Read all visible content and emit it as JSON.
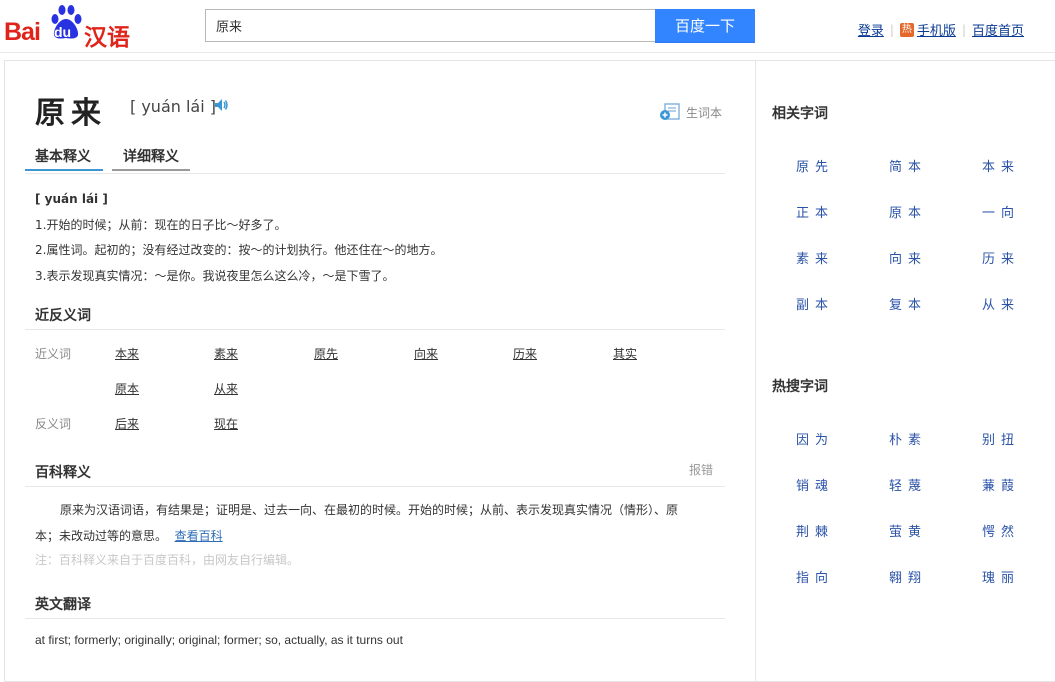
{
  "header": {
    "logo": {
      "bai": "Bai",
      "du": "du",
      "hanyu": "汉语"
    },
    "search_value": "原来",
    "search_button": "百度一下",
    "links": {
      "login": "登录",
      "hot_badge": "热",
      "mobile": "手机版",
      "home": "百度首页"
    }
  },
  "entry": {
    "word": "原来",
    "pinyin": "[ yuán lái ]",
    "add_newword": "生词本",
    "tabs": [
      "基本释义",
      "详细释义"
    ],
    "basic": {
      "pinyin": "[ yuán lái ]",
      "defs": [
        "1.开始的时候；从前：现在的日子比～好多了。",
        "2.属性词。起初的；没有经过改变的：按～的计划执行。他还住在～的地方。",
        "3.表示发现真实情况：～是你。我说夜里怎么这么冷，～是下雪了。"
      ]
    },
    "synonyms_section": {
      "title": "近反义词",
      "synonym_label": "近义词",
      "synonyms": [
        "本来",
        "素来",
        "原先",
        "向来",
        "历来",
        "其实",
        "原本",
        "从来"
      ],
      "antonym_label": "反义词",
      "antonyms": [
        "后来",
        "现在"
      ]
    },
    "baike": {
      "title": "百科释义",
      "report": "报错",
      "text": "原来为汉语词语，有结果是；证明是、过去一向、在最初的时候。开始的时候；从前、表示发现真实情况（情形）、原本；未改动过等的意思。",
      "link": "查看百科",
      "note": "注：百科释义来自于百度百科，由网友自行编辑。"
    },
    "english": {
      "title": "英文翻译",
      "text": "at first; formerly; originally; original; former; so, actually, as it turns out"
    }
  },
  "sidebar": {
    "related_title": "相关字词",
    "related": [
      "原先",
      "简本",
      "本来",
      "正本",
      "原本",
      "一向",
      "素来",
      "向来",
      "历来",
      "副本",
      "复本",
      "从来"
    ],
    "hot_title": "热搜字词",
    "hot": [
      "因为",
      "朴素",
      "别扭",
      "销魂",
      "轻蔑",
      "蒹葭",
      "荆棘",
      "萤黄",
      "愕然",
      "指向",
      "翱翔",
      "瑰丽"
    ]
  },
  "colors": {
    "brand_red": "#e1241b",
    "brand_blue": "#2932e1",
    "button_blue": "#3385ff",
    "link_blue": "#2b53a8"
  }
}
